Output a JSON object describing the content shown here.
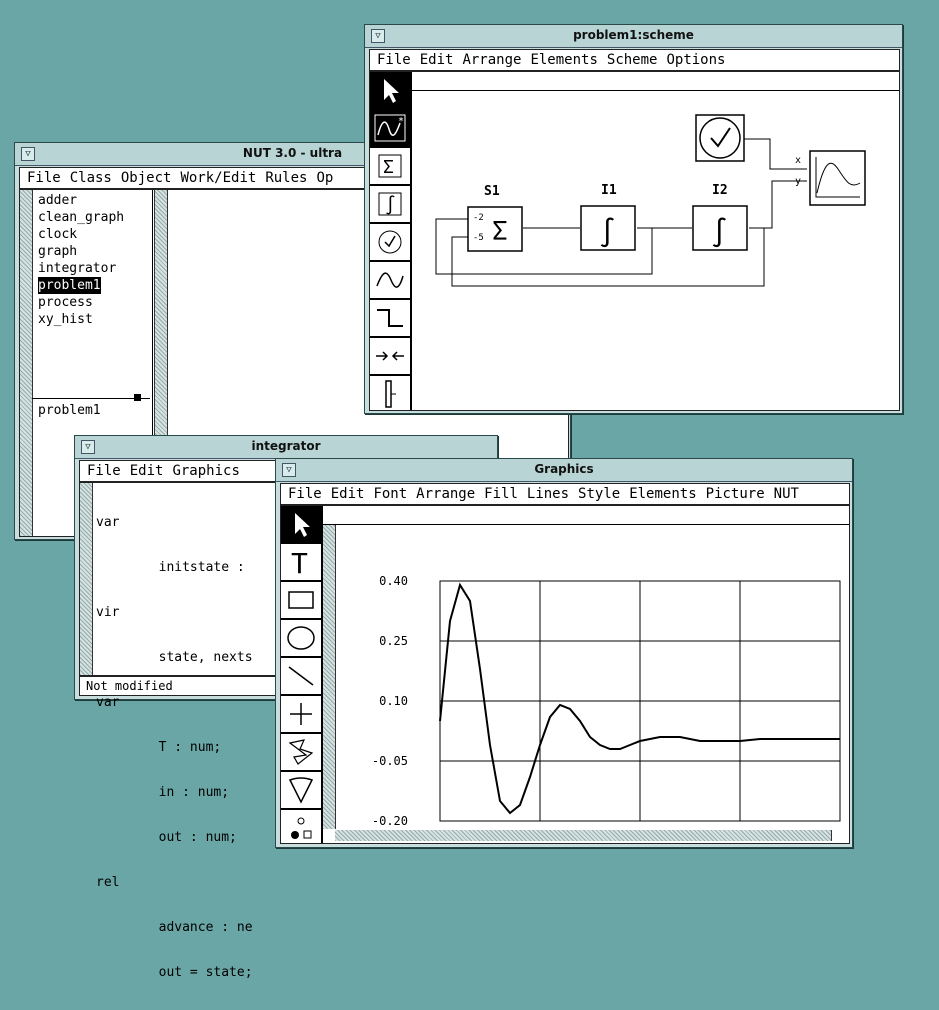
{
  "nut_window": {
    "title": "NUT 3.0 - ultra",
    "menu": [
      "File",
      "Class",
      "Object",
      "Work/Edit",
      "Rules",
      "Op"
    ],
    "classes": [
      "adder",
      "clean_graph",
      "clock",
      "graph",
      "integrator",
      "problem1",
      "process",
      "xy_hist"
    ],
    "selected_class": "problem1",
    "object_list": [
      "problem1"
    ]
  },
  "integrator_window": {
    "title": "integrator",
    "menu": [
      "File",
      "Edit",
      "Graphics"
    ],
    "code_lines": [
      "var",
      "        initstate :",
      "vir",
      "        state, nexts",
      "var",
      "        T : num;",
      "        in : num;",
      "        out : num;",
      "rel",
      "        advance : ne",
      "        out = state;"
    ],
    "status": "Not modified"
  },
  "scheme_window": {
    "title": "problem1:scheme",
    "menu": [
      "File",
      "Edit",
      "Arrange",
      "Elements",
      "Scheme",
      "Options"
    ],
    "tools": [
      "pointer-icon",
      "graph-element-icon",
      "adder-icon",
      "integrator-icon",
      "clock-icon",
      "wave-icon",
      "step-icon",
      "connect-icon",
      "port-icon"
    ],
    "labels": {
      "s1": "S1",
      "i1": "I1",
      "i2": "I2",
      "x": "x",
      "y": "y",
      "in1": "-2",
      "in2": "-5"
    }
  },
  "graphics_window": {
    "title": "Graphics",
    "menu": [
      "File",
      "Edit",
      "Font",
      "Arrange",
      "Fill",
      "Lines",
      "Style",
      "Elements",
      "Picture",
      "NUT"
    ],
    "tools": [
      "pointer-icon",
      "text-tool-icon",
      "rectangle-tool-icon",
      "ellipse-tool-icon",
      "line-tool-icon",
      "cross-tool-icon",
      "polygon-tool-icon",
      "arc-tool-icon",
      "fill-pattern-icon"
    ],
    "chart_data": {
      "type": "line",
      "y_ticks": [
        "0.40",
        "0.25",
        "0.10",
        "-0.05",
        "-0.20"
      ],
      "ylim": [
        -0.2,
        0.4
      ],
      "xlim": [
        0,
        40
      ],
      "grid": true,
      "series": [
        {
          "x": [
            0,
            1,
            2,
            3,
            4,
            5,
            6,
            7,
            8,
            9,
            10,
            11,
            12,
            13,
            14,
            15,
            16,
            17,
            18,
            19,
            20,
            22,
            24,
            26,
            28,
            30,
            32,
            34,
            36,
            38,
            40
          ],
          "values": [
            0.05,
            0.3,
            0.39,
            0.35,
            0.18,
            -0.01,
            -0.15,
            -0.18,
            -0.16,
            -0.09,
            -0.01,
            0.06,
            0.09,
            0.08,
            0.05,
            0.01,
            -0.01,
            -0.02,
            -0.02,
            -0.01,
            0.0,
            0.01,
            0.01,
            0.0,
            -0.0,
            0.0,
            0.005,
            0.005,
            0.005,
            0.005,
            0.005
          ]
        }
      ]
    }
  }
}
